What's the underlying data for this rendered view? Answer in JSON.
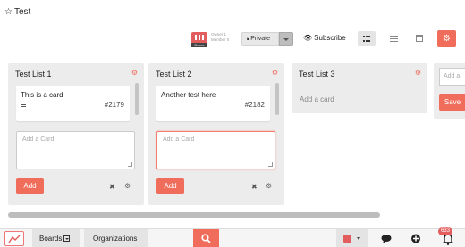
{
  "board": {
    "title": "Test"
  },
  "toolbar": {
    "owner_tag": "Owner",
    "owner_line1": "Owner 1",
    "owner_line2": "Member 0",
    "privacy_label": "Private",
    "subscribe_label": "Subscribe",
    "views": [
      "grid-view-icon",
      "list-view-icon",
      "calendar-view-icon"
    ],
    "active_view": "grid"
  },
  "lists": [
    {
      "title": "Test List 1",
      "cards": [
        {
          "title": "This is a card",
          "number": "#2179",
          "has_description": true
        }
      ],
      "add_card_placeholder": "Add a Card",
      "add_button": "Add"
    },
    {
      "title": "Test List 2",
      "cards": [
        {
          "title": "Another test here",
          "number": "#2182",
          "has_description": false
        }
      ],
      "add_card_placeholder": "Add a Card",
      "add_button": "Add"
    },
    {
      "title": "Test List 3",
      "cards": [],
      "add_card_link": "Add a card"
    }
  ],
  "new_list": {
    "placeholder": "Add a",
    "save_label": "Save"
  },
  "bottombar": {
    "boards_label": "Boards",
    "organizations_label": "Organizations",
    "notification_count": "633"
  },
  "colors": {
    "accent": "#f06d5c",
    "list_bg": "#ececec",
    "owner": "#e25d5d"
  }
}
